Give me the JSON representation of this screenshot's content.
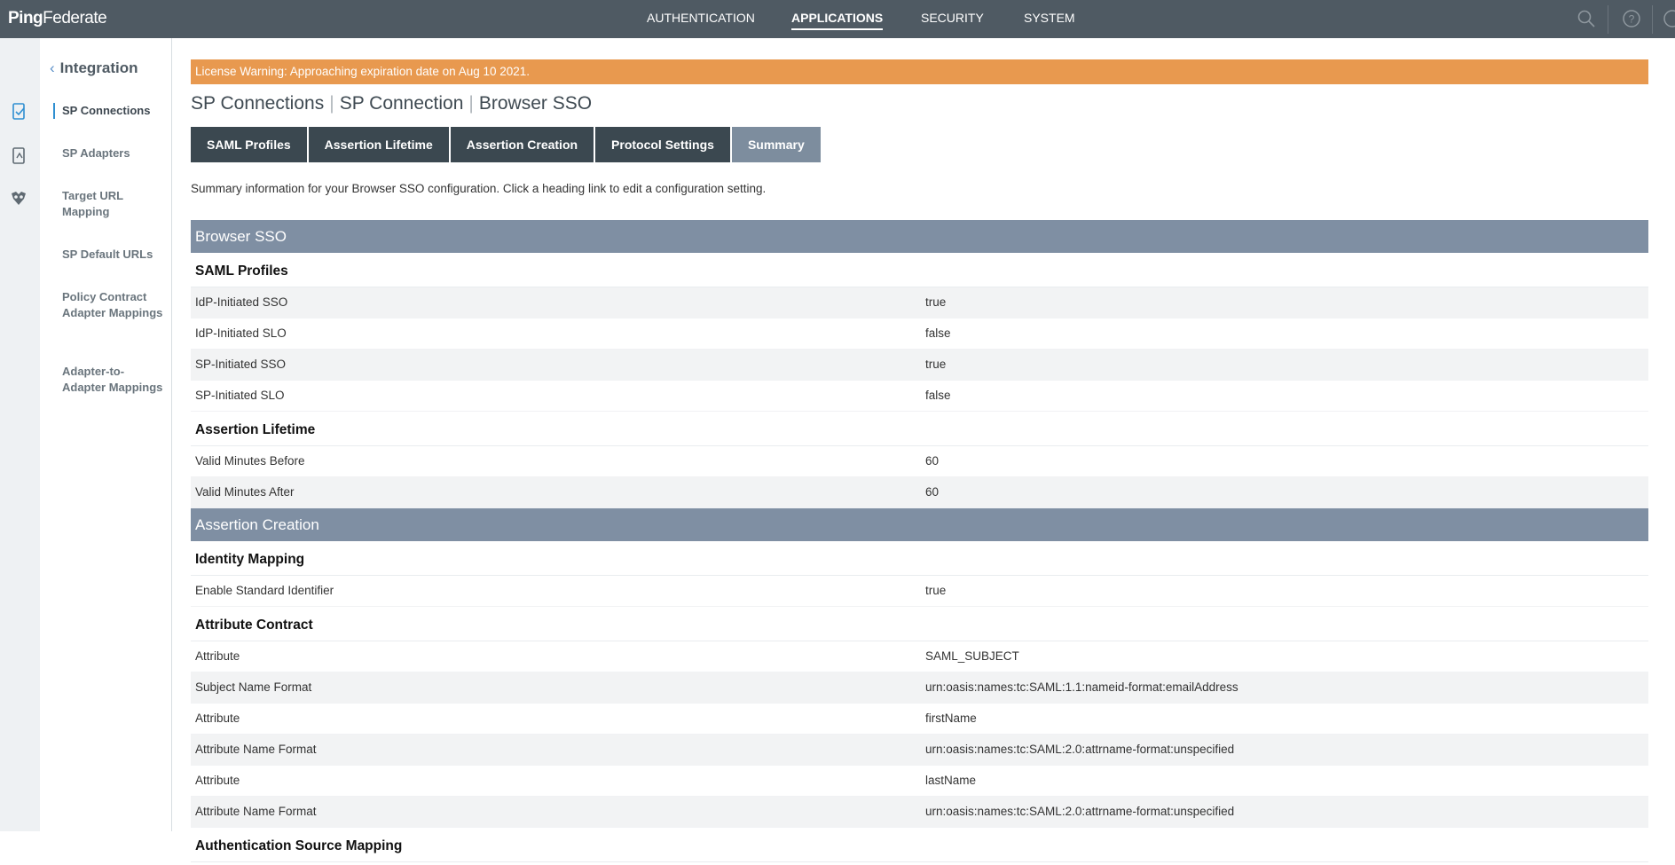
{
  "app": {
    "logo_bold": "Ping",
    "logo_rest": "Federate"
  },
  "topnav": {
    "items": [
      "AUTHENTICATION",
      "APPLICATIONS",
      "SECURITY",
      "SYSTEM"
    ],
    "active": "APPLICATIONS",
    "icons": [
      "search-icon",
      "help-icon",
      "user-icon"
    ]
  },
  "rail": {
    "icons": [
      "sp-connections-icon",
      "adapters-icon",
      "mappings-icon"
    ]
  },
  "subnav": {
    "back_label": "Integration",
    "items": [
      {
        "label": "SP Connections",
        "active": true
      },
      {
        "label": "SP Adapters"
      },
      {
        "label": "Target URL Mapping"
      },
      {
        "label": "SP Default URLs"
      },
      {
        "label": "Policy Contract Adapter Mappings"
      },
      {
        "label": "Adapter-to-Adapter Mappings"
      }
    ]
  },
  "warning": "License Warning: Approaching expiration date on Aug 10 2021.",
  "breadcrumb": [
    "SP Connections",
    "SP Connection",
    "Browser SSO"
  ],
  "tabs": [
    "SAML Profiles",
    "Assertion Lifetime",
    "Assertion Creation",
    "Protocol Settings",
    "Summary"
  ],
  "active_tab": "Summary",
  "intro": "Summary information for your Browser SSO configuration. Click a heading link to edit a configuration setting.",
  "summary": {
    "browser_sso": "Browser SSO",
    "saml_profiles": "SAML Profiles",
    "saml_rows": [
      {
        "k": "IdP-Initiated SSO",
        "v": "true"
      },
      {
        "k": "IdP-Initiated SLO",
        "v": "false"
      },
      {
        "k": "SP-Initiated SSO",
        "v": "true"
      },
      {
        "k": "SP-Initiated SLO",
        "v": "false"
      }
    ],
    "assertion_lifetime": "Assertion Lifetime",
    "lifetime_rows": [
      {
        "k": "Valid Minutes Before",
        "v": "60"
      },
      {
        "k": "Valid Minutes After",
        "v": "60"
      }
    ],
    "assertion_creation": "Assertion Creation",
    "identity_mapping": "Identity Mapping",
    "identity_rows": [
      {
        "k": "Enable Standard Identifier",
        "v": "true"
      }
    ],
    "attribute_contract": "Attribute Contract",
    "attribute_rows": [
      {
        "k": "Attribute",
        "v": "SAML_SUBJECT"
      },
      {
        "k": "Subject Name Format",
        "v": "urn:oasis:names:tc:SAML:1.1:nameid-format:emailAddress"
      },
      {
        "k": "Attribute",
        "v": "firstName"
      },
      {
        "k": "Attribute Name Format",
        "v": "urn:oasis:names:tc:SAML:2.0:attrname-format:unspecified"
      },
      {
        "k": "Attribute",
        "v": "lastName"
      },
      {
        "k": "Attribute Name Format",
        "v": "urn:oasis:names:tc:SAML:2.0:attrname-format:unspecified"
      }
    ],
    "next_header": "Authentication Source Mapping"
  }
}
